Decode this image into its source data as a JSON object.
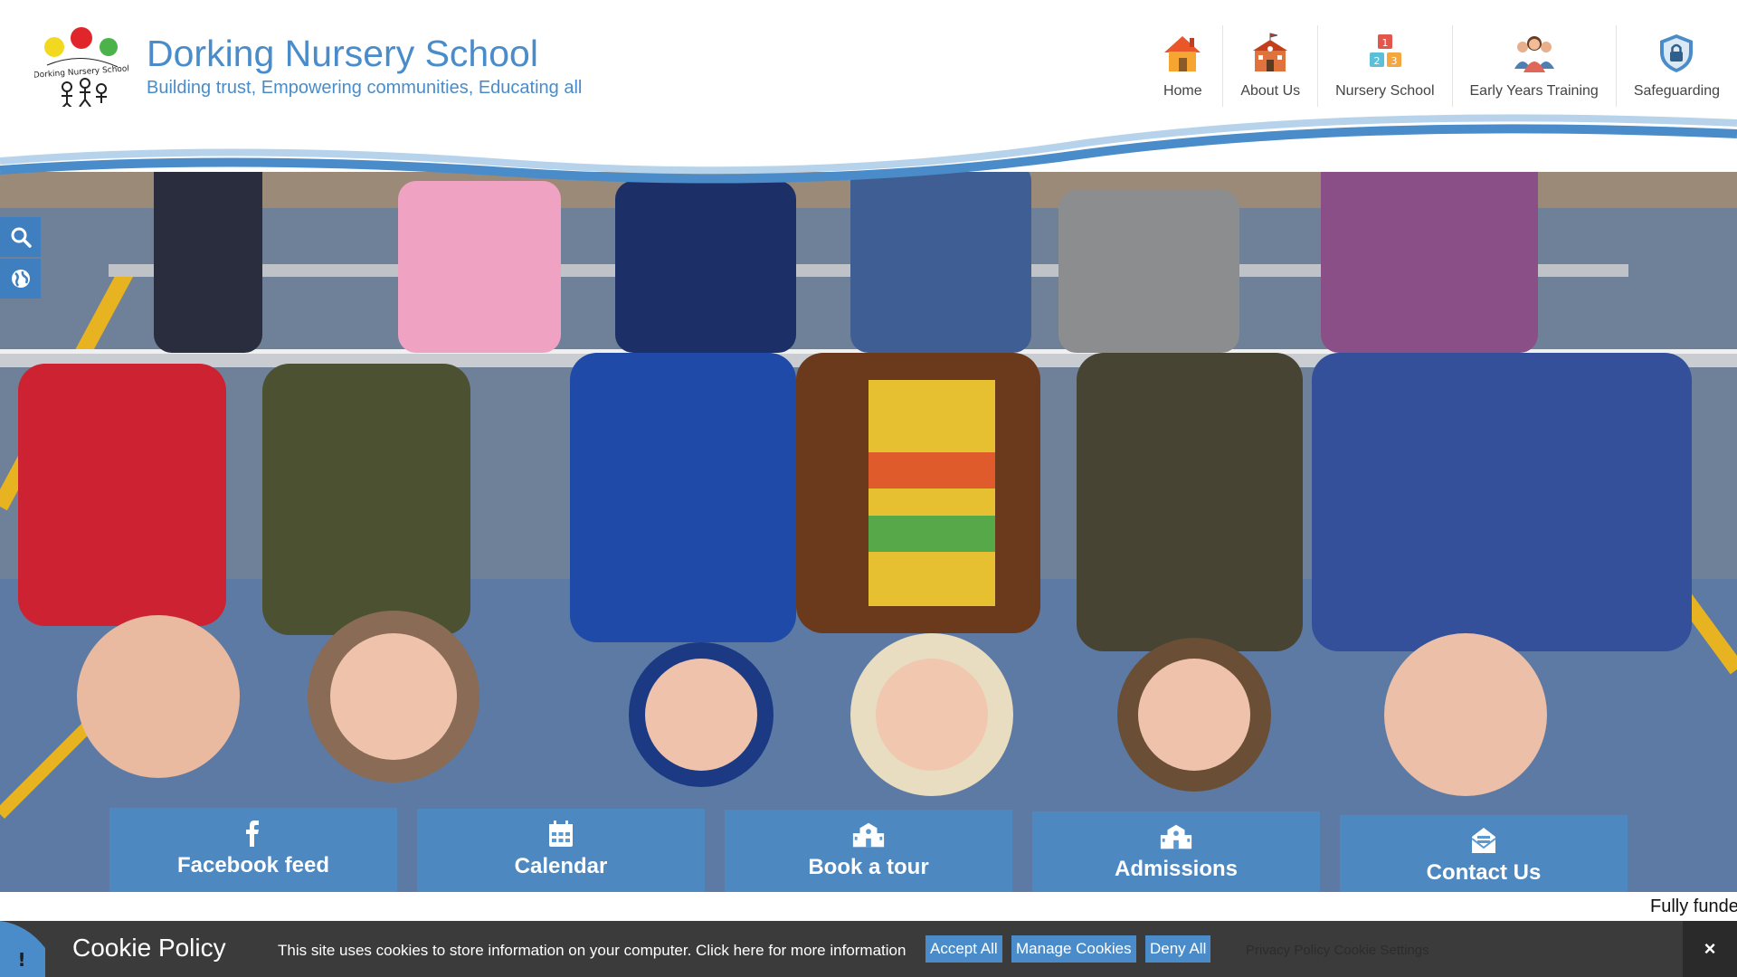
{
  "header": {
    "title": "Dorking Nursery School",
    "tagline": "Building trust, Empowering communities, Educating all",
    "logo_text": "Dorking Nursery School"
  },
  "nav": [
    {
      "label": "Home",
      "icon": "house-icon"
    },
    {
      "label": "About Us",
      "icon": "school-building-icon"
    },
    {
      "label": "Nursery School",
      "icon": "number-blocks-icon"
    },
    {
      "label": "Early Years Training",
      "icon": "people-group-icon"
    },
    {
      "label": "Safeguarding",
      "icon": "shield-lock-icon"
    }
  ],
  "side_tools": [
    {
      "icon": "search-icon"
    },
    {
      "icon": "globe-icon"
    }
  ],
  "quick_links": [
    {
      "label": "Facebook feed",
      "icon": "facebook-icon"
    },
    {
      "label": "Calendar",
      "icon": "calendar-icon"
    },
    {
      "label": "Book a tour",
      "icon": "school-icon"
    },
    {
      "label": "Admissions",
      "icon": "school-icon"
    },
    {
      "label": "Contact Us",
      "icon": "envelope-icon"
    }
  ],
  "ticker": {
    "text": "Fully funde"
  },
  "cookie": {
    "title": "Cookie Policy",
    "text": "This site uses cookies to store information on your computer. Click here for more information",
    "accept": "Accept All",
    "manage": "Manage Cookies",
    "deny": "Deny All",
    "links": "Privacy Policy  Cookie Settings",
    "close": "×",
    "flag": "!"
  },
  "colors": {
    "brand_blue": "#4a8cc9",
    "side_blue": "#3f7fbf",
    "cookie_bg": "#3b3b3b"
  }
}
